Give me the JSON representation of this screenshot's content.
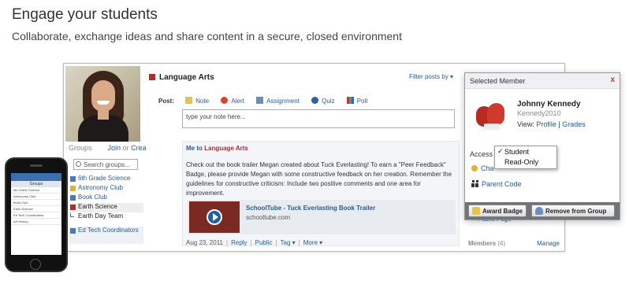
{
  "header": {
    "title": "Engage your students",
    "subtitle": "Collaborate, exchange ideas and share content in a secure, closed environment"
  },
  "groups": {
    "label": "Groups",
    "join": "Join",
    "or": "or",
    "create": "Create",
    "search_placeholder": "Search groups...",
    "items": [
      {
        "label": "6th Grade Science",
        "color": "#4a7bb7"
      },
      {
        "label": "Astronomy Club",
        "color": "#e0b030"
      },
      {
        "label": "Book Club",
        "color": "#4a7bb7"
      },
      {
        "label": "Earth Science",
        "color": "#b22b2b"
      },
      {
        "label": "Earth Day Team"
      },
      {
        "label": "Ed Tech Coordinators",
        "color": "#4a7bb7"
      }
    ]
  },
  "feed": {
    "group_title": "Language Arts",
    "filter_label": "Filter posts by ▾",
    "post_label": "Post:",
    "post_options": [
      "Note",
      "Alert",
      "Assignment",
      "Quiz",
      "Poll"
    ],
    "note_placeholder": "type your note here...",
    "message": {
      "from": "Me",
      "to_word": "to",
      "group": "Language Arts",
      "body": "Check out the book trailer Megan created about Tuck Everlasting! To earn a \"Peer Feedback\" Badge, please provide Megan with some constructive feedback on her creation. Remember the guidelines for constructive criticism: Include two positive comments and one area for improvement.",
      "link_title": "SchoolTube - Tuck Everlasting Book Trailer",
      "link_url": "schooltube.com",
      "date": "Aug 23, 2011",
      "actions": [
        "Reply",
        "Public",
        "Tag ▾",
        "More ▾"
      ]
    }
  },
  "right": {
    "public_page": "Public Page",
    "members_label": "Members",
    "members_count": "(4)",
    "manage": "Manage"
  },
  "popup": {
    "title": "Selected Member",
    "close": "x",
    "name": "Johnny Kennedy",
    "username": "Kennedy2010",
    "view_label": "View:",
    "profile": "Profile",
    "grades": "Grades",
    "access_label": "Access",
    "change_partial": "Cha",
    "parent_code": "Parent Code",
    "dropdown": [
      {
        "label": "Student",
        "checked": true
      },
      {
        "label": "Read-Only",
        "checked": false
      }
    ],
    "award_badge": "Award Badge",
    "remove_group": "Remove from Group"
  },
  "phone": {
    "screen_title": "Groups",
    "rows": [
      "6th Grade Science",
      "Astronomy Club",
      "Book Club",
      "Earth Science",
      "Ed Tech Coordinators",
      "Art History"
    ]
  },
  "colors": {
    "accent_red": "#b22b2b",
    "link_blue": "#2a5a9a"
  }
}
